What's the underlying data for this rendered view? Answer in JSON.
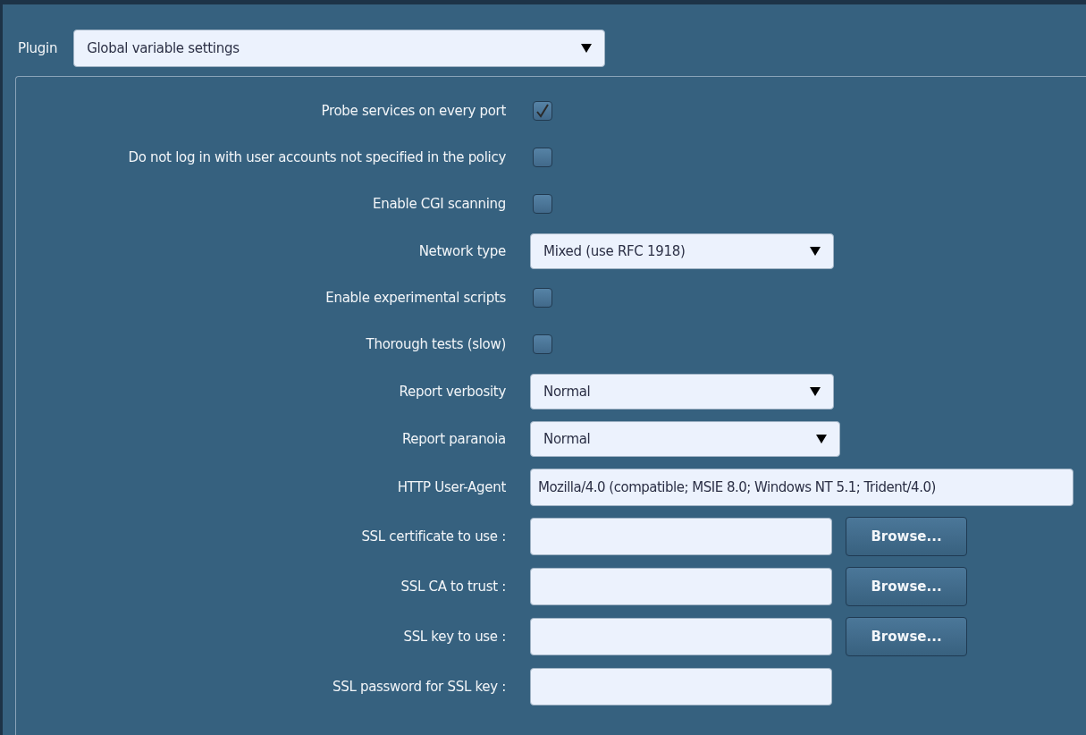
{
  "plugin": {
    "label": "Plugin",
    "value": "Global variable settings"
  },
  "settings": [
    {
      "kind": "checkbox",
      "label": "Probe services on every port",
      "checked": true
    },
    {
      "kind": "checkbox",
      "label": "Do not log in with user accounts not specified in the policy",
      "checked": false
    },
    {
      "kind": "checkbox",
      "label": "Enable CGI scanning",
      "checked": false
    },
    {
      "kind": "select",
      "label": "Network type",
      "value": "Mixed (use RFC 1918)"
    },
    {
      "kind": "checkbox",
      "label": "Enable experimental scripts",
      "checked": false
    },
    {
      "kind": "checkbox",
      "label": "Thorough tests (slow)",
      "checked": false
    },
    {
      "kind": "select",
      "label": "Report verbosity",
      "value": "Normal"
    },
    {
      "kind": "select",
      "label": "Report paranoia",
      "value": "Normal"
    },
    {
      "kind": "text",
      "label": "HTTP User-Agent",
      "value": "Mozilla/4.0 (compatible; MSIE 8.0; Windows NT 5.1; Trident/4.0)"
    },
    {
      "kind": "file",
      "label": "SSL certificate to use :",
      "button": "Browse..."
    },
    {
      "kind": "file",
      "label": "SSL CA to trust :",
      "button": "Browse..."
    },
    {
      "kind": "file",
      "label": "SSL key to use :",
      "button": "Browse..."
    },
    {
      "kind": "text",
      "label": "SSL password for SSL key :"
    }
  ]
}
